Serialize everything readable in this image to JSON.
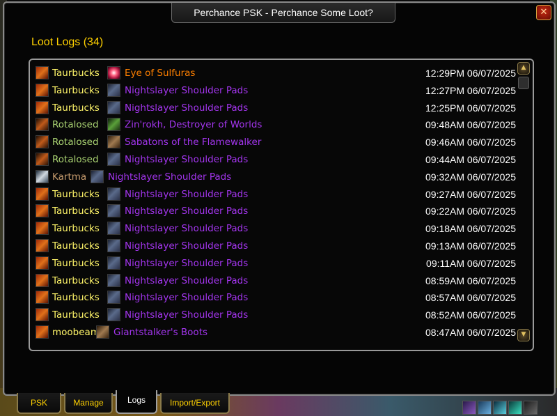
{
  "window": {
    "title": "Perchance PSK - Perchance Some Loot?",
    "close_label": "✕"
  },
  "section": {
    "title": "Loot Logs (34)"
  },
  "logs": [
    {
      "player": "Taurbucks",
      "player_color": "#fff569",
      "class_icon": "rogue-class-icon",
      "item": "Eye of Sulfuras",
      "item_quality": "legendary",
      "item_icon": "eye-of-sulfuras-icon",
      "time": "12:29PM 06/07/2025"
    },
    {
      "player": "Taurbucks",
      "player_color": "#fff569",
      "class_icon": "rogue-class-icon",
      "item": "Nightslayer Shoulder Pads",
      "item_quality": "epic",
      "item_icon": "shoulder-pads-icon",
      "time": "12:27PM 06/07/2025"
    },
    {
      "player": "Taurbucks",
      "player_color": "#fff569",
      "class_icon": "rogue-class-icon",
      "item": "Nightslayer Shoulder Pads",
      "item_quality": "epic",
      "item_icon": "shoulder-pads-icon",
      "time": "12:25PM 06/07/2025"
    },
    {
      "player": "Rotalosed",
      "player_color": "#abd473",
      "class_icon": "druid-class-icon",
      "item": "Zin'rokh, Destroyer of Worlds",
      "item_quality": "epic",
      "item_icon": "axe-icon",
      "time": "09:48AM 06/07/2025"
    },
    {
      "player": "Rotalosed",
      "player_color": "#abd473",
      "class_icon": "druid-class-icon",
      "item": "Sabatons of the Flamewalker",
      "item_quality": "epic",
      "item_icon": "boots-icon",
      "time": "09:46AM 06/07/2025"
    },
    {
      "player": "Rotalosed",
      "player_color": "#abd473",
      "class_icon": "druid-class-icon",
      "item": "Nightslayer Shoulder Pads",
      "item_quality": "epic",
      "item_icon": "shoulder-pads-icon",
      "time": "09:44AM 06/07/2025"
    },
    {
      "player": "Kartma",
      "player_color": "#c79c6e",
      "class_icon": "warrior-class-icon",
      "item": "Nightslayer Shoulder Pads",
      "item_quality": "epic",
      "item_icon": "shoulder-pads-icon",
      "time": "09:32AM 06/07/2025"
    },
    {
      "player": "Taurbucks",
      "player_color": "#fff569",
      "class_icon": "rogue-class-icon",
      "item": "Nightslayer Shoulder Pads",
      "item_quality": "epic",
      "item_icon": "shoulder-pads-icon",
      "time": "09:27AM 06/07/2025"
    },
    {
      "player": "Taurbucks",
      "player_color": "#fff569",
      "class_icon": "rogue-class-icon",
      "item": "Nightslayer Shoulder Pads",
      "item_quality": "epic",
      "item_icon": "shoulder-pads-icon",
      "time": "09:22AM 06/07/2025"
    },
    {
      "player": "Taurbucks",
      "player_color": "#fff569",
      "class_icon": "rogue-class-icon",
      "item": "Nightslayer Shoulder Pads",
      "item_quality": "epic",
      "item_icon": "shoulder-pads-icon",
      "time": "09:18AM 06/07/2025"
    },
    {
      "player": "Taurbucks",
      "player_color": "#fff569",
      "class_icon": "rogue-class-icon",
      "item": "Nightslayer Shoulder Pads",
      "item_quality": "epic",
      "item_icon": "shoulder-pads-icon",
      "time": "09:13AM 06/07/2025"
    },
    {
      "player": "Taurbucks",
      "player_color": "#fff569",
      "class_icon": "rogue-class-icon",
      "item": "Nightslayer Shoulder Pads",
      "item_quality": "epic",
      "item_icon": "shoulder-pads-icon",
      "time": "09:11AM 06/07/2025"
    },
    {
      "player": "Taurbucks",
      "player_color": "#fff569",
      "class_icon": "rogue-class-icon",
      "item": "Nightslayer Shoulder Pads",
      "item_quality": "epic",
      "item_icon": "shoulder-pads-icon",
      "time": "08:59AM 06/07/2025"
    },
    {
      "player": "Taurbucks",
      "player_color": "#fff569",
      "class_icon": "rogue-class-icon",
      "item": "Nightslayer Shoulder Pads",
      "item_quality": "epic",
      "item_icon": "shoulder-pads-icon",
      "time": "08:57AM 06/07/2025"
    },
    {
      "player": "Taurbucks",
      "player_color": "#fff569",
      "class_icon": "rogue-class-icon",
      "item": "Nightslayer Shoulder Pads",
      "item_quality": "epic",
      "item_icon": "shoulder-pads-icon",
      "time": "08:52AM 06/07/2025"
    },
    {
      "player": "moobeam",
      "player_color": "#fff569",
      "class_icon": "rogue-class-icon",
      "item": "Giantstalker's Boots",
      "item_quality": "epic",
      "item_icon": "boots-icon",
      "time": "08:47AM 06/07/2025"
    }
  ],
  "colors": {
    "legendary": "#ff8000",
    "epic": "#a335ee",
    "title_gold": "#ffd100"
  },
  "scrollbar": {
    "up_icon": "scroll-up-icon",
    "down_icon": "scroll-down-icon"
  },
  "tabs": [
    {
      "label": "PSK",
      "active": false
    },
    {
      "label": "Manage",
      "active": false
    },
    {
      "label": "Logs",
      "active": true
    },
    {
      "label": "Import/Export",
      "active": false
    }
  ]
}
